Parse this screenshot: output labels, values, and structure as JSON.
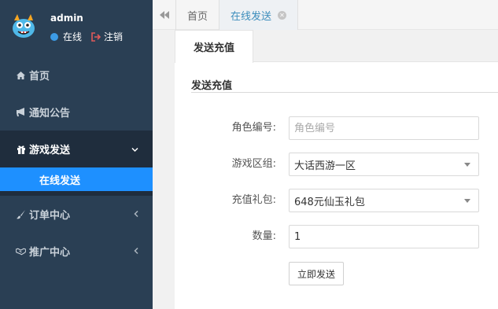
{
  "user": {
    "name": "admin",
    "status": "在线",
    "logout": "注销"
  },
  "sidebar": {
    "items": [
      {
        "label": "首页",
        "icon": "home-icon"
      },
      {
        "label": "通知公告",
        "icon": "bullhorn-icon"
      },
      {
        "label": "游戏发送",
        "icon": "gift-icon",
        "open": true,
        "children": [
          {
            "label": "在线发送"
          }
        ]
      },
      {
        "label": "订单中心",
        "icon": "brush-icon"
      },
      {
        "label": "推广中心",
        "icon": "handshake-icon"
      }
    ]
  },
  "tabs": [
    {
      "label": "首页"
    },
    {
      "label": "在线发送",
      "active": true
    }
  ],
  "panel": {
    "tab": "发送充值",
    "section_title": "发送充值",
    "fields": {
      "role_id": {
        "label": "角色编号:",
        "placeholder": "角色编号",
        "value": ""
      },
      "zone": {
        "label": "游戏区组:",
        "value": "大话西游一区"
      },
      "gift": {
        "label": "充值礼包:",
        "value": "648元仙玉礼包"
      },
      "qty": {
        "label": "数量:",
        "value": "1"
      }
    },
    "submit": "立即发送"
  },
  "colors": {
    "sidebar_bg": "#2a3f54",
    "active_item": "#1e90ff",
    "online_dot": "#3c9be6",
    "tab_active_text": "#3c8dbc"
  }
}
